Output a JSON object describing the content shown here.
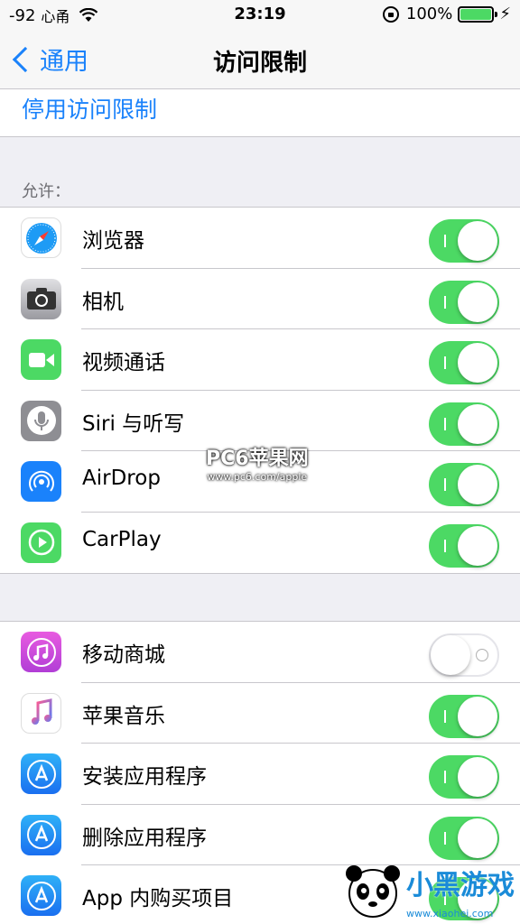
{
  "status_bar": {
    "signal": "-92",
    "carrier": "心甬",
    "time": "23:19",
    "battery": "100%"
  },
  "nav": {
    "back_label": "通用",
    "title": "访问限制"
  },
  "disable_label": "停用访问限制",
  "section_allow": "允许：",
  "group1": [
    {
      "label": "浏览器",
      "icon": "safari-icon",
      "on": true
    },
    {
      "label": "相机",
      "icon": "camera-icon",
      "on": true
    },
    {
      "label": "视频通话",
      "icon": "facetime-icon",
      "on": true
    },
    {
      "label": "Siri 与听写",
      "icon": "siri-icon",
      "on": true
    },
    {
      "label": "AirDrop",
      "icon": "airdrop-icon",
      "on": true
    },
    {
      "label": "CarPlay",
      "icon": "carplay-icon",
      "on": true
    }
  ],
  "group2": [
    {
      "label": "移动商城",
      "icon": "itunes-store-icon",
      "on": false
    },
    {
      "label": "苹果音乐",
      "icon": "music-icon",
      "on": true
    },
    {
      "label": "安装应用程序",
      "icon": "app-store-icon",
      "on": true
    },
    {
      "label": "删除应用程序",
      "icon": "app-store-icon",
      "on": true
    },
    {
      "label": "App 内购买项目",
      "icon": "app-store-icon",
      "on": true
    }
  ],
  "watermark": {
    "title": "PC6苹果网",
    "url": "www.pc6.com/apple"
  },
  "logo": {
    "text": "小黑游戏",
    "url": "www.xiaohei.com"
  },
  "colors": {
    "accent": "#1a82fb",
    "switch_on": "#4cd964"
  }
}
